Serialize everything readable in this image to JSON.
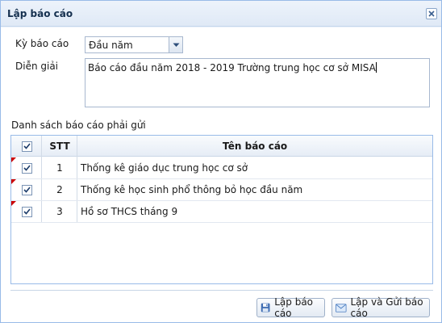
{
  "window": {
    "title": "Lập báo cáo"
  },
  "form": {
    "period_label": "Kỳ báo cáo",
    "period_value": "Đầu năm",
    "description_label": "Diễn giải",
    "description_value": "Báo cáo đầu năm 2018 - 2019 Trường trung học cơ sở MISA"
  },
  "report_list": {
    "title": "Danh sách báo cáo phải gửi",
    "columns": {
      "stt": "STT",
      "name": "Tên báo cáo"
    },
    "rows": [
      {
        "stt": "1",
        "name": "Thống kê giáo dục trung học cơ sở",
        "checked": true
      },
      {
        "stt": "2",
        "name": "Thống kê học sinh phổ thông bỏ học đầu năm",
        "checked": true
      },
      {
        "stt": "3",
        "name": "Hồ sơ THCS tháng 9",
        "checked": true
      }
    ]
  },
  "buttons": {
    "create_label": "Lập báo cáo",
    "create_send_label": "Lập và Gửi báo cáo"
  },
  "icons": {
    "close": "close-icon",
    "dropdown": "chevron-down-icon",
    "create": "floppy-disk-icon",
    "send": "envelope-icon",
    "check": "checkmark-icon"
  },
  "colors": {
    "border_accent": "#99bbe8",
    "title_text": "#15304f",
    "dirty_marker": "#cc0000"
  }
}
